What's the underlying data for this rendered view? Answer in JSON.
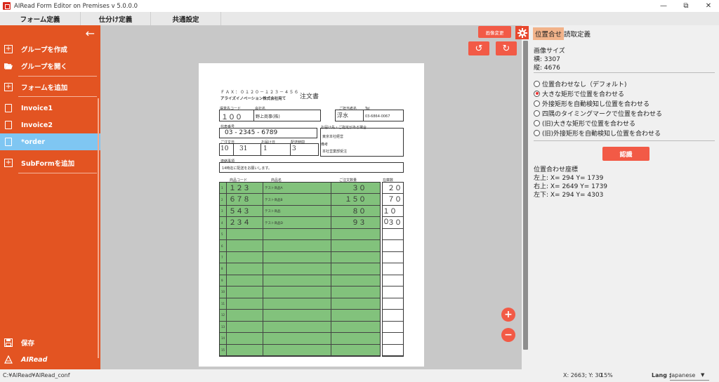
{
  "window": {
    "title": "AIRead Form Editor on Premises v 5.0.0.0",
    "minimize": "—",
    "restore": "⧉",
    "close": "✕"
  },
  "menubar": [
    {
      "label": "フォーム定義"
    },
    {
      "label": "仕分け定義"
    },
    {
      "label": "共通設定"
    }
  ],
  "sidebar": {
    "back": "←",
    "items": [
      {
        "label": "グループを作成",
        "icon": "plus-box-icon"
      },
      {
        "label": "グループを開く",
        "icon": "folder-open-icon"
      },
      {
        "label": "フォームを追加",
        "icon": "plus-box-icon"
      },
      {
        "label": "Invoice1",
        "icon": "document-icon"
      },
      {
        "label": "Invoice2",
        "icon": "document-icon"
      },
      {
        "label": "*order",
        "icon": "document-icon"
      },
      {
        "label": "SubFormを追加",
        "icon": "plus-box-icon"
      }
    ],
    "save_label": "保存",
    "logo": "AIRead"
  },
  "toolbar": {
    "change_image": "画像変更",
    "rotate_left": "↺",
    "rotate_right": "↻",
    "zoom_in": "+",
    "zoom_out": "−"
  },
  "form": {
    "fax": "ＦＡＸ：０１２０－１２３－４５６",
    "addressee": "アライズイノベーション株式会社宛て",
    "title": "注文書",
    "label_customer_code": "得意先コード",
    "label_company": "会社名",
    "label_person": "ご担当者名",
    "label_tel": "Tel",
    "customer_code": "１００",
    "company": "野上商事(株)",
    "person": "浮水",
    "tel": "03-6864-0067",
    "label_phone": "代表番号",
    "phone": "03 - 2345 - 6789",
    "label_delivery": "お届け先・ご指定がある場合",
    "delivery_line1": "東京本社経営",
    "label_date": "ご注文日",
    "date_month": "10",
    "date_day": "31",
    "label_delivery_date": "お届け日",
    "delivery_day": "1",
    "label_time": "配送時間",
    "time_value": "3",
    "label_remarks": "備考",
    "remarks_value": "本社営業部受注",
    "label_notes": "連絡事項",
    "notes": "14時迄に配送をお願いします。",
    "col_code": "商品コード",
    "col_name": "商品名",
    "col_qty": "ご注文数量",
    "col_stock": "在庫数",
    "rows": [
      {
        "no": "1",
        "code": "１２３",
        "name": "テスト商品A",
        "qty": "３０",
        "stock": "２０"
      },
      {
        "no": "2",
        "code": "６７８",
        "name": "テスト商品B",
        "qty": "１５０",
        "stock": "７０"
      },
      {
        "no": "3",
        "code": "５４３",
        "name": "テスト商品",
        "qty": "８０",
        "stock": "１００"
      },
      {
        "no": "4",
        "code": "２３４",
        "name": "テスト商品D",
        "qty": "９３",
        "stock": "３０"
      },
      {
        "no": "5"
      },
      {
        "no": "6"
      },
      {
        "no": "7"
      },
      {
        "no": "8"
      },
      {
        "no": "9"
      },
      {
        "no": "10"
      },
      {
        "no": "11"
      },
      {
        "no": "12"
      },
      {
        "no": "13"
      },
      {
        "no": "14"
      },
      {
        "no": "15"
      }
    ]
  },
  "panel": {
    "tabs": [
      {
        "label": "位置合せ"
      },
      {
        "label": "読取定義"
      }
    ],
    "image_size_title": "画像サイズ",
    "width_label": "横: 3307",
    "height_label": "縦: 4676",
    "options": [
      {
        "label": "位置合わせなし（デフォルト)",
        "selected": false
      },
      {
        "label": "大きな矩形で位置を合わせる",
        "selected": true
      },
      {
        "label": "外接矩形を自動検知し位置を合わせる",
        "selected": false
      },
      {
        "label": "四隅のタイミングマークで位置を合わせる",
        "selected": false
      },
      {
        "label": "(旧)大きな矩形で位置を合わせる",
        "selected": false
      },
      {
        "label": "(旧)外接矩形を自動検知し位置を合わせる",
        "selected": false
      }
    ],
    "recognize_button": "認識",
    "coords_title": "位置合わせ座標",
    "top_left": "左上: X= 294   Y= 1739",
    "top_right": "右上: X= 2649   Y= 1739",
    "bottom_left": "左下: X= 294   Y= 4303"
  },
  "status": {
    "path": "C:¥AIRead¥AIRead_conf",
    "coords": "X: 2663; Y: 30",
    "zoom": "15%",
    "lang_label": "Lang :",
    "lang_value": "Japanese",
    "lang_arrow": "▼"
  },
  "colors": {
    "accent": "#e35422",
    "selected": "#7fc6f2",
    "table_fill": "#82c27c",
    "button_red": "#f25a46"
  }
}
